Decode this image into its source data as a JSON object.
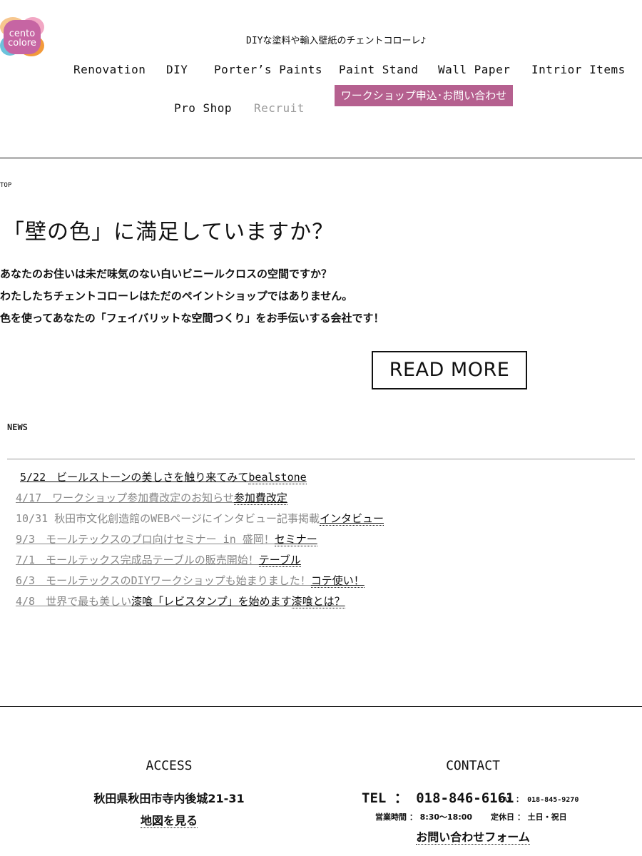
{
  "header": {
    "logo_text": [
      "cento",
      "colore"
    ],
    "tagline": "DIYな塗料や輸入壁紙のチェントコローレ♪",
    "nav": [
      {
        "label": "Renovation"
      },
      {
        "label": "DIY"
      },
      {
        "label": "Porter’s Paints"
      },
      {
        "label": "Paint Stand"
      },
      {
        "label": "Wall Paper"
      },
      {
        "label": "Intrior Items"
      },
      {
        "label": "Pro Shop"
      },
      {
        "label": "Recruit"
      }
    ],
    "cta_label": "ワークショップ申込･お問い合わせ",
    "cta_color": "#b5608f"
  },
  "breadcrumb": "TOP",
  "hero": {
    "title": "「壁の色」に満足していますか？",
    "lines": [
      "あなたのお住いは未だ味気のない白いビニールクロスの空間ですか？",
      "わたしたちチェントコローレはただのペイントショップではありません。",
      "色を使ってあなたの「フェイバリットな空間つくり」をお手伝いする会社です！"
    ],
    "read_more": "READ MORE"
  },
  "news": {
    "label": "NEWS",
    "items": [
      {
        "main": "5/22　ビールストーンの美しさを触り来てみて",
        "tag": "bealstone"
      },
      {
        "main": "4/17　ワークショップ参加費改定のお知らせ",
        "tag": "参加費改定"
      },
      {
        "main": "10/31 秋田市文化創造館のWEBページにインタビュー記事掲載",
        "tag": "インタビュー"
      },
      {
        "main": "9/3　モールテックスのプロ向けセミナー in 盛岡！",
        "tag": "セミナー"
      },
      {
        "main": "7/1　モールテックス完成品テーブルの販売開始！",
        "tag": "テーブル"
      },
      {
        "main": "6/3　モールテックスのDIYワークショップも始まりました！",
        "tag": "コテ使い！"
      },
      {
        "main": "4/8　世界で最も美しい",
        "main2": "漆喰「レビスタンプ」を始めます",
        "tag": "漆喰とは？"
      }
    ]
  },
  "footer": {
    "access": {
      "heading": "ACCESS",
      "address": "秋田県秋田市寺内後城21-31",
      "map_link": "地図を見る"
    },
    "contact": {
      "heading": "CONTACT",
      "tel": "TEL ： 018-846-6161",
      "fax": "FAX ： 018-845-9270",
      "hours": "営業時間 ： 8:30～18:00",
      "closed": "定休日 ： 土日・祝日",
      "form_link": "お問い合わせフォーム"
    }
  }
}
